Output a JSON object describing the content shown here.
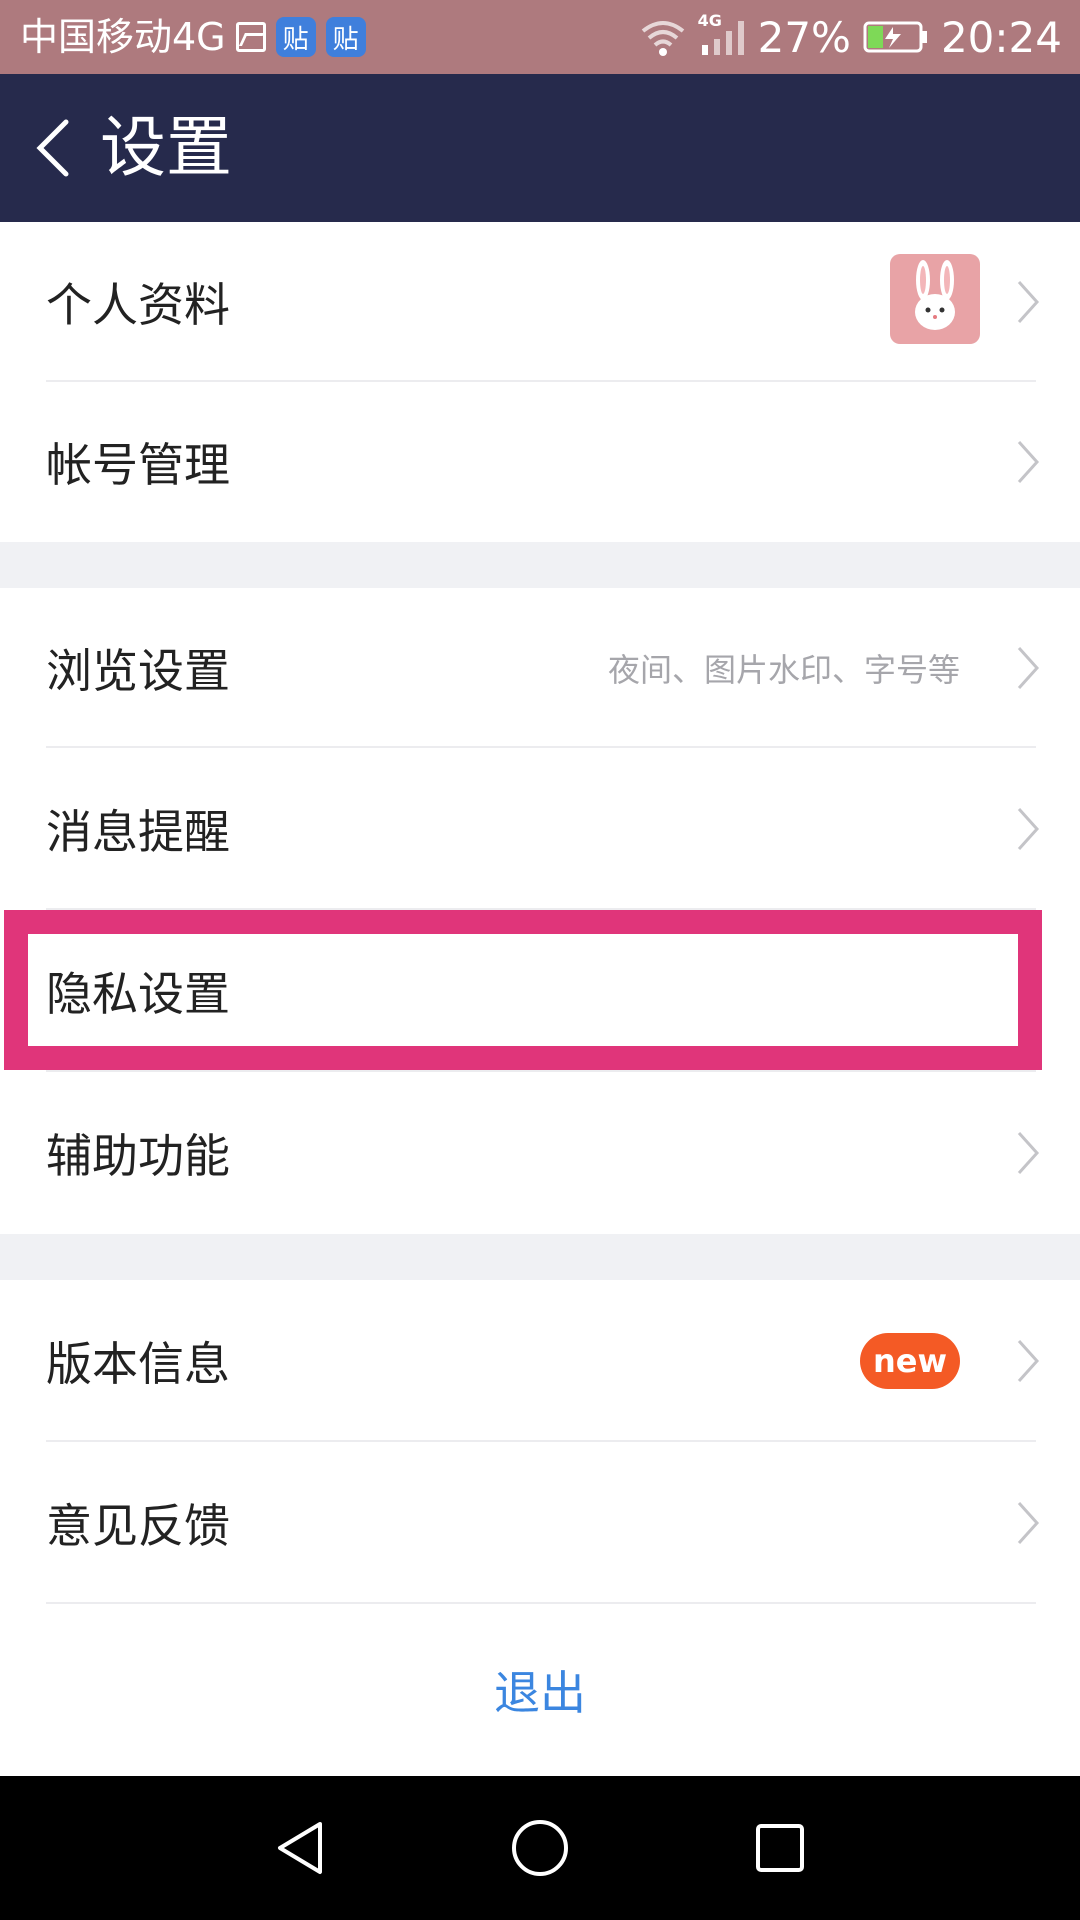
{
  "status_bar": {
    "carrier": "中国移动4G",
    "tieba_badge_1": "贴",
    "tieba_badge_2": "贴",
    "network_type": "4G",
    "battery_percent": "27%",
    "time": "20:24",
    "icons": [
      "image-icon",
      "tieba-icon",
      "tieba-icon",
      "wifi-icon",
      "signal-icon",
      "battery-charging-icon"
    ]
  },
  "header": {
    "title": "设置",
    "back_icon": "chevron-left-icon"
  },
  "sections": [
    {
      "items": [
        {
          "label": "个人资料",
          "trailing": "avatar"
        },
        {
          "label": "帐号管理"
        }
      ]
    },
    {
      "items": [
        {
          "label": "浏览设置",
          "hint": "夜间、图片水印、字号等"
        },
        {
          "label": "消息提醒"
        },
        {
          "label": "隐私设置",
          "highlighted": true
        },
        {
          "label": "辅助功能"
        }
      ]
    },
    {
      "items": [
        {
          "label": "版本信息",
          "badge": "new"
        },
        {
          "label": "意见反馈"
        }
      ]
    }
  ],
  "logout": {
    "label": "退出"
  },
  "nav_bar": {
    "icons": [
      "back-triangle-icon",
      "home-circle-icon",
      "recents-square-icon"
    ]
  },
  "colors": {
    "status_bar": "#ae7a7e",
    "header": "#262a4c",
    "highlight": "#e0357a",
    "badge": "#f45a25",
    "logout_text": "#3b86e0"
  }
}
